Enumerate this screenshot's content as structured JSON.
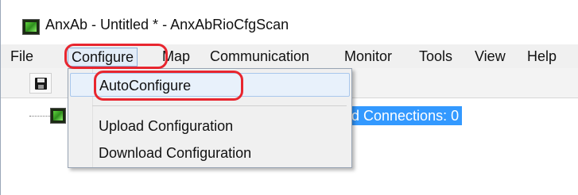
{
  "window": {
    "title": "AnxAb - Untitled * - AnxAbRioCfgScan"
  },
  "menubar": {
    "items": [
      {
        "label": "File"
      },
      {
        "label": "Configure"
      },
      {
        "label": "Map"
      },
      {
        "label": "Communication"
      },
      {
        "label": "Monitor"
      },
      {
        "label": "Tools"
      },
      {
        "label": "View"
      },
      {
        "label": "Help"
      }
    ]
  },
  "toolbar": {
    "save_icon": "floppy-disk-icon"
  },
  "tree": {
    "node_label": "ired Connections: 0"
  },
  "dropdown": {
    "items": [
      {
        "label": "AutoConfigure"
      },
      {
        "label": "Upload Configuration"
      },
      {
        "label": "Download Configuration"
      }
    ]
  },
  "annotation": {
    "color": "#e8262f"
  }
}
